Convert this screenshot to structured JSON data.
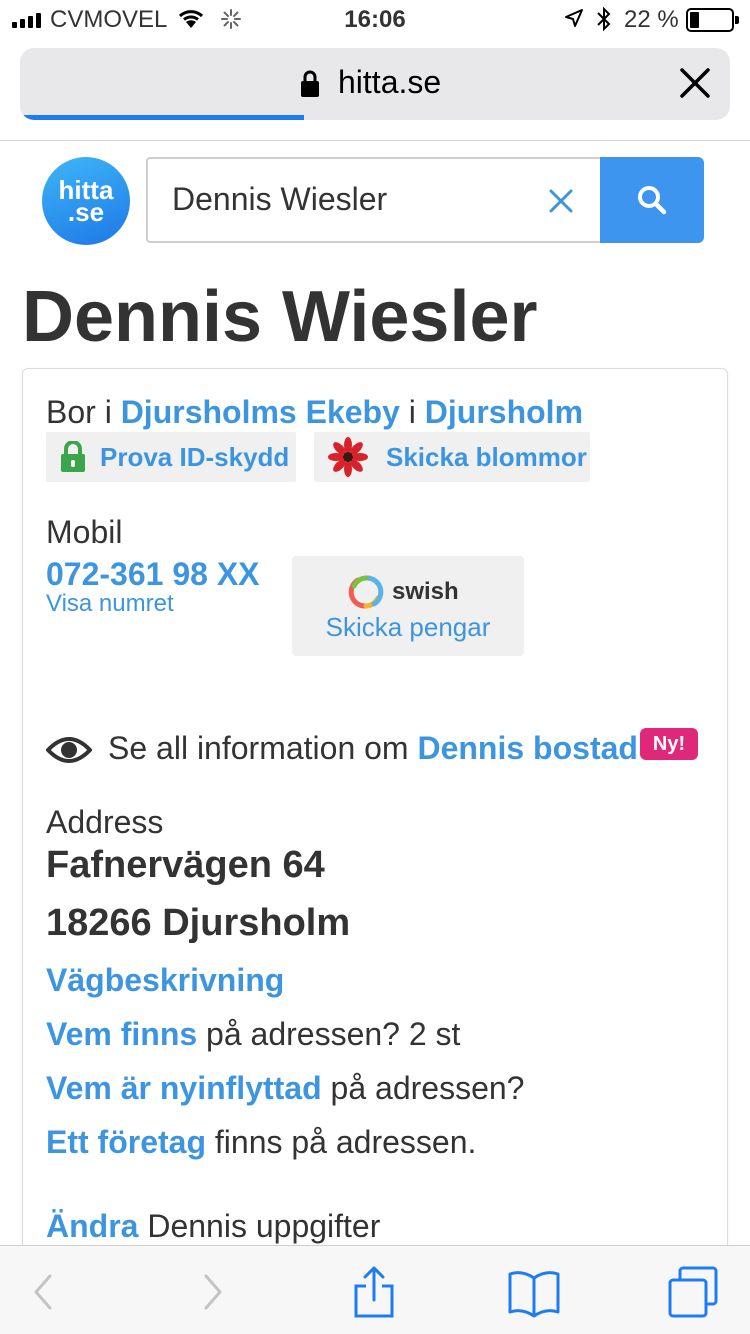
{
  "status": {
    "carrier": "CVMOVEL",
    "time": "16:06",
    "battery": "22 %",
    "battery_level": 0.22
  },
  "browser": {
    "url": "hitta.se",
    "load_progress": 0.4
  },
  "header": {
    "logo_line1": "hitta",
    "logo_line2": ".se",
    "search_value": "Dennis Wiesler"
  },
  "person": {
    "name": "Dennis Wiesler",
    "lives_prefix": "Bor i ",
    "area": "Djursholms Ekeby",
    "lives_mid": " i ",
    "city": "Djursholm",
    "id_protect": "Prova ID-skydd",
    "send_flowers": "Skicka blommor",
    "mobile_label": "Mobil",
    "phone": "072-361 98 XX",
    "show_number": "Visa numret",
    "swish_brand": "swish",
    "swish_action": "Skicka pengar",
    "info_prefix": "Se all information om ",
    "info_link": "Dennis bostad",
    "new_badge": "Ny!",
    "address_label": "Address",
    "street": "Fafnervägen 64",
    "postal": "18266 Djursholm",
    "directions": "Vägbeskrivning",
    "who_link": "Vem finns",
    "who_rest": " på adressen? 2 st",
    "newly_link": "Vem är nyinflyttad",
    "newly_rest": " på adressen?",
    "company_link": "Ett företag",
    "company_rest": " finns på adressen.",
    "edit_link": "Ändra",
    "edit_rest": " Dennis uppgifter"
  },
  "icons": {
    "lock": "lock-icon",
    "close": "close-icon",
    "search": "search-icon",
    "eye": "eye-icon",
    "flower": "flower-icon",
    "back": "back-icon",
    "forward": "forward-icon",
    "share": "share-icon",
    "bookmarks": "bookmarks-icon",
    "tabs": "tabs-icon"
  },
  "colors": {
    "link": "#3d95e0",
    "search_button": "#3d95f0",
    "badge": "#e0287a",
    "progress": "#1f7cf0"
  }
}
